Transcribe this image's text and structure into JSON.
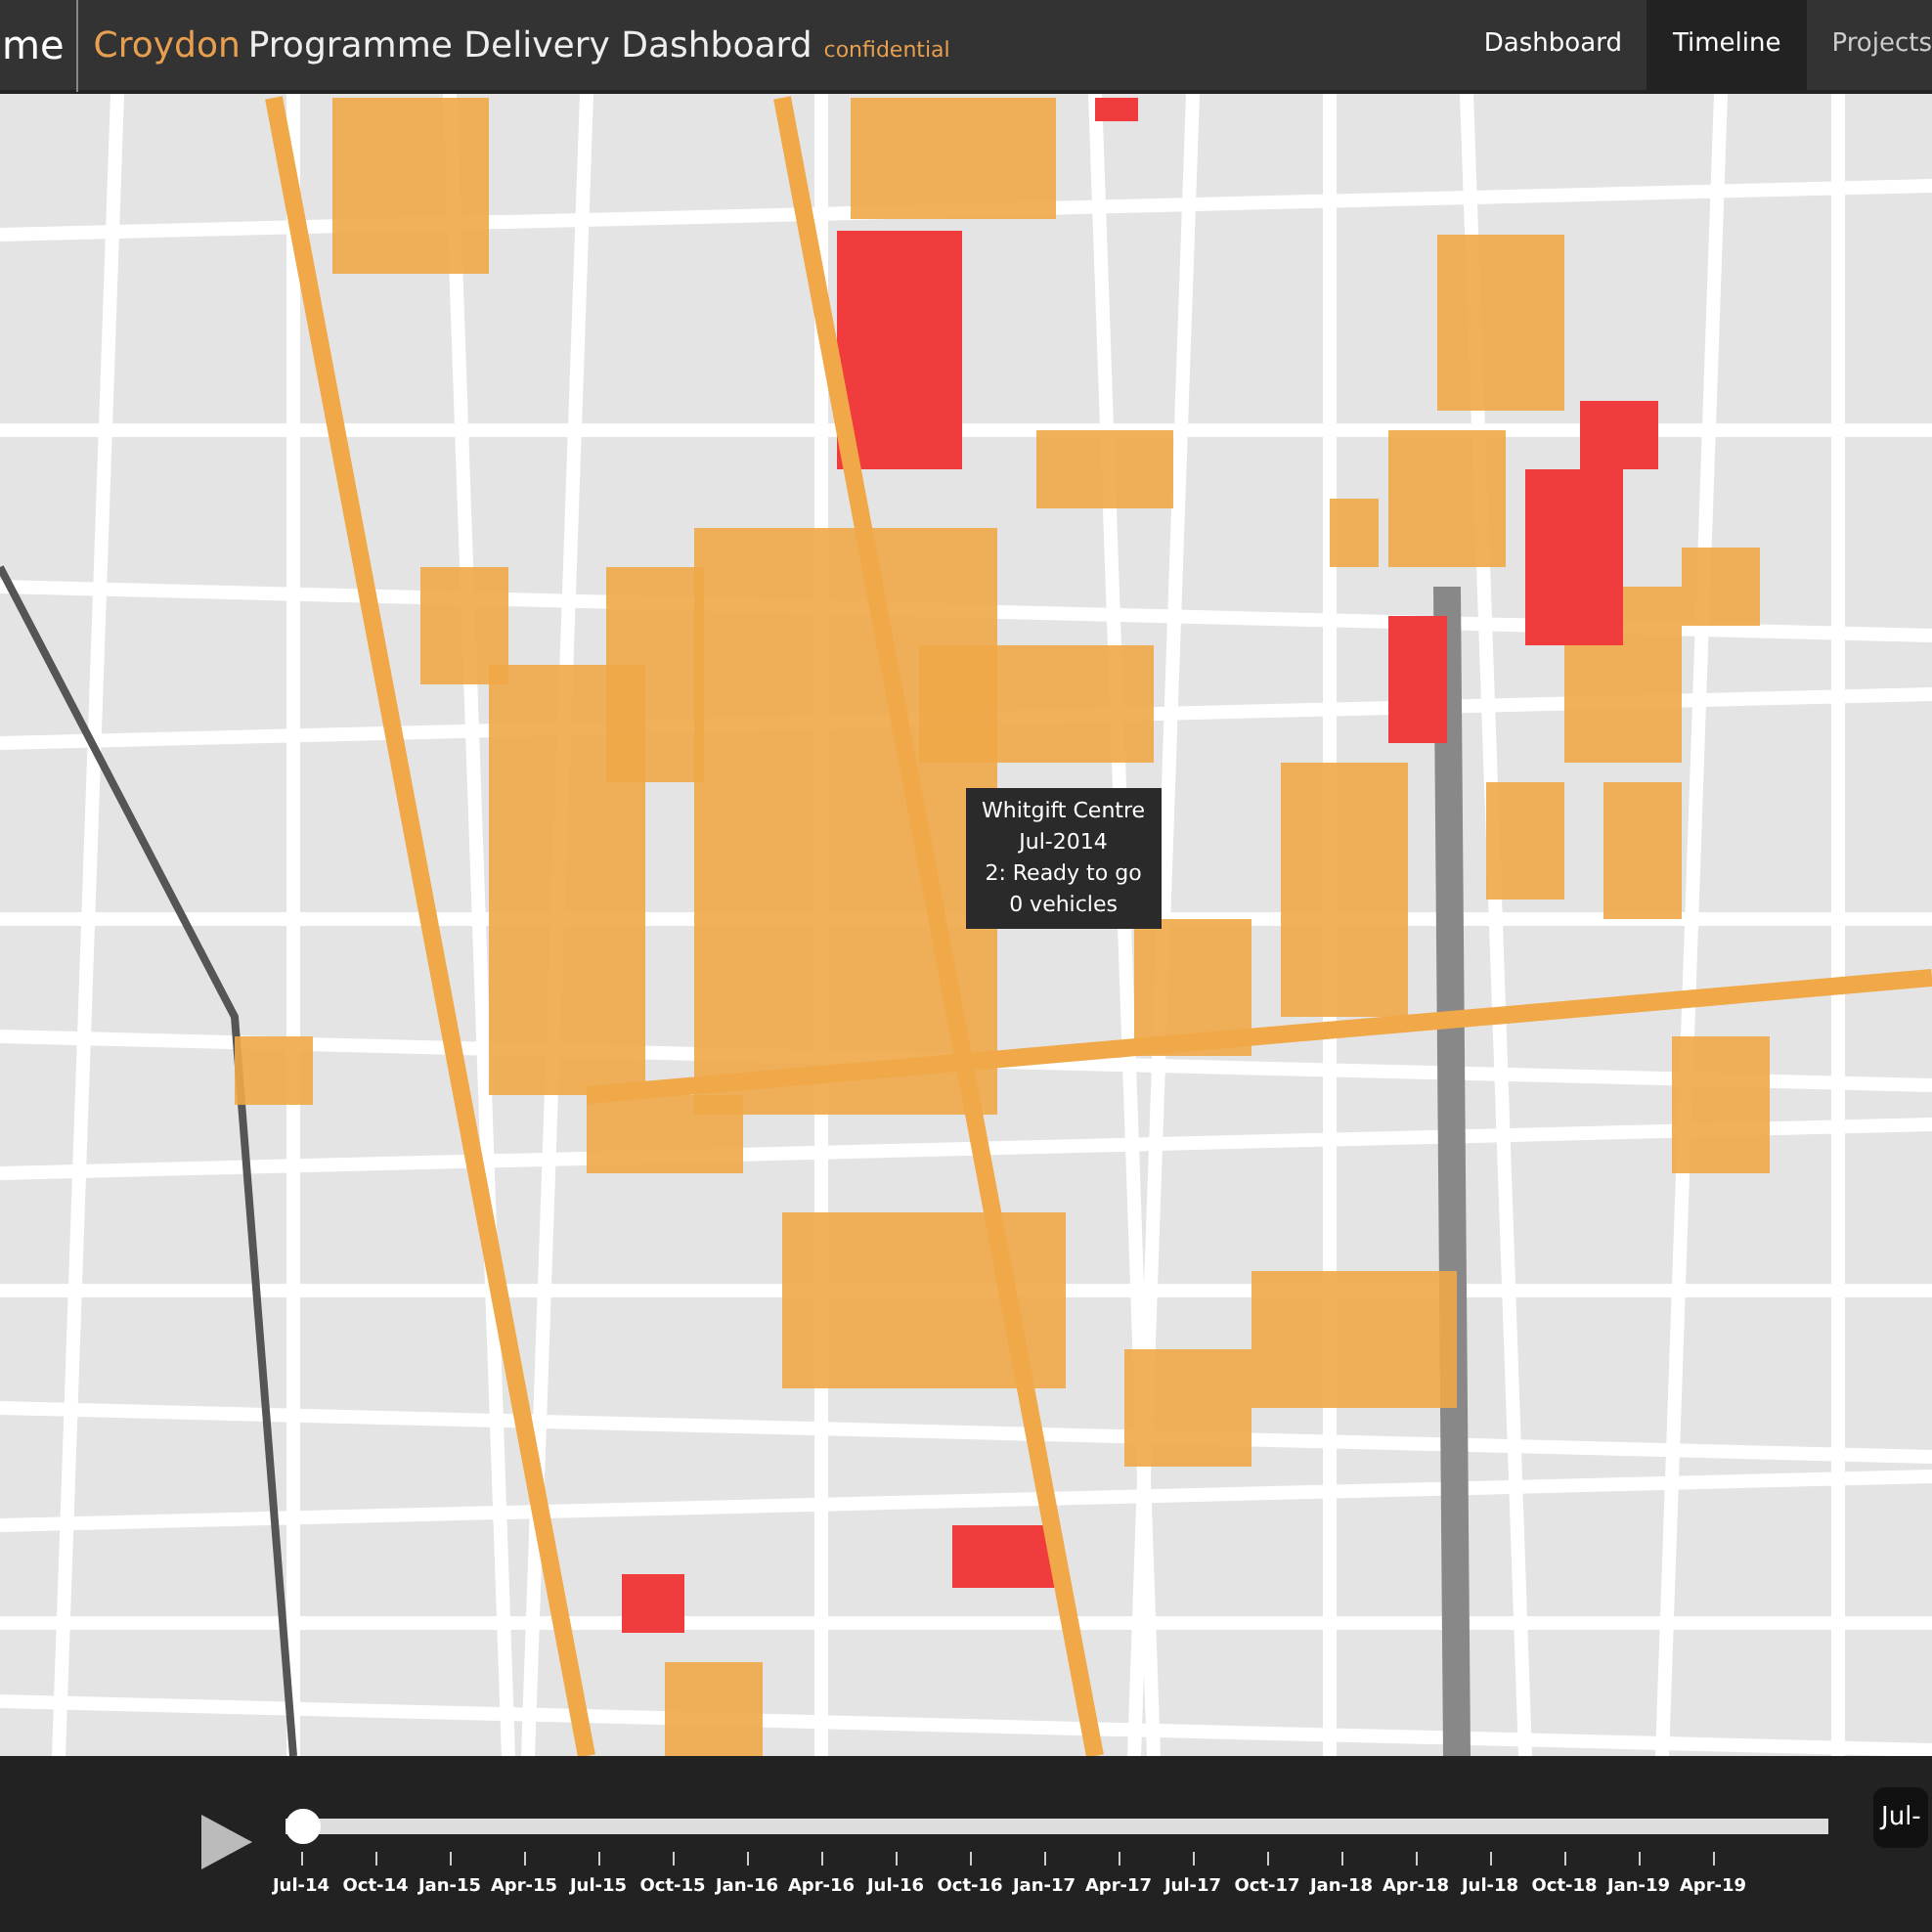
{
  "header": {
    "brand_fragment": "me",
    "title_highlight": "Croydon",
    "title": "Programme Delivery Dashboard",
    "badge": "confidential"
  },
  "nav": [
    {
      "label": "Dashboard",
      "selected": false
    },
    {
      "label": "Timeline",
      "selected": true
    },
    {
      "label": "Projects",
      "selected": false
    }
  ],
  "tooltip": {
    "lines": [
      "Whitgift Centre",
      "Jul-2014",
      "2: Ready to go",
      "0 vehicles"
    ]
  },
  "timeline": {
    "level": 0,
    "current": "Jul-",
    "ticks": [
      "Jul-14",
      "Oct-14",
      "Jan-15",
      "Apr-15",
      "Jul-15",
      "Oct-15",
      "Jan-16",
      "Apr-16",
      "Jul-16",
      "Oct-16",
      "Jan-17",
      "Apr-17",
      "Jul-17",
      "Oct-17",
      "Jan-18",
      "Apr-18",
      "Jul-18",
      "Oct-18",
      "Jan-19",
      "Apr-19"
    ]
  }
}
